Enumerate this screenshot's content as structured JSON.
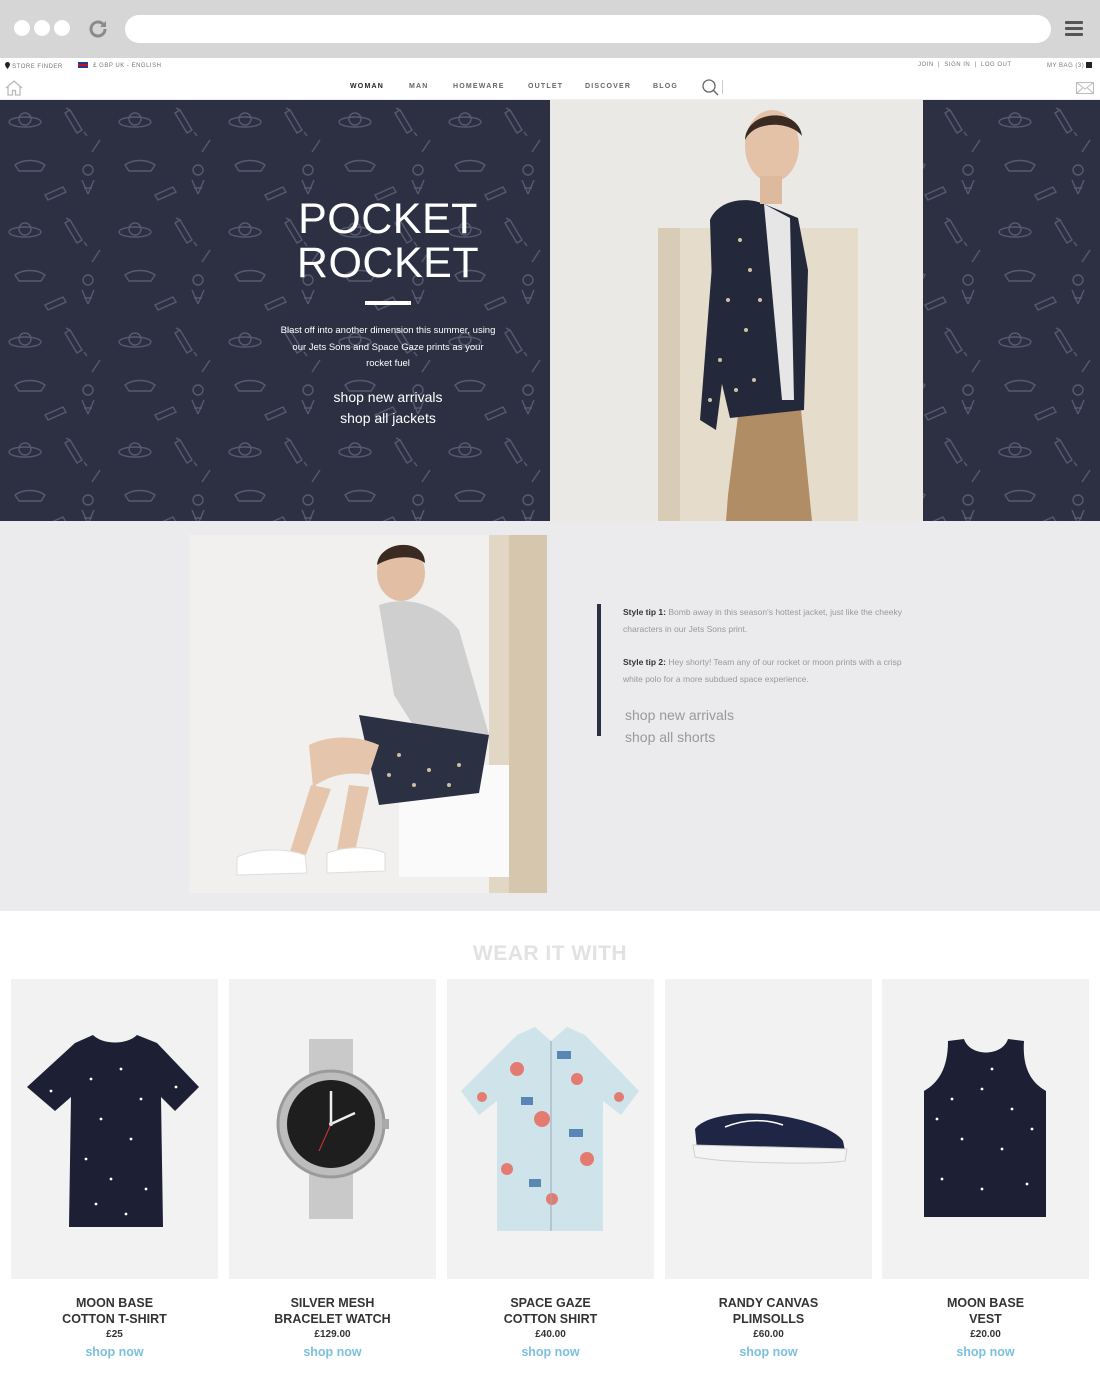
{
  "utility": {
    "store_finder": "STORE FINDER",
    "currency": "£ GBP UK - ENGLISH",
    "join": "JOIN",
    "sign_in": "SIGN IN",
    "log_out": "LOG OUT",
    "bag": "MY BAG (3)"
  },
  "nav": {
    "items": [
      "WOMAN",
      "MAN",
      "HOMEWARE",
      "OUTLET",
      "DISCOVER",
      "BLOG"
    ],
    "active": "WOMAN"
  },
  "hero": {
    "title_line1": "POCKET",
    "title_line2": "ROCKET",
    "text": "Blast off into another dimension this summer, using our Jets Sons and Space Gaze prints as your rocket fuel",
    "link1": "shop new arrivals",
    "link2": "shop all jackets"
  },
  "tips": {
    "tip1_label": "Style tip 1:",
    "tip1_text": " Bomb away in this season's hottest jacket, just like the cheeky characters in our Jets Sons print.",
    "tip2_label": "Style tip 2:",
    "tip2_text": " Hey shorty! Team any of our rocket or moon prints with a crisp white polo for a more subdued space experience.",
    "link1": "shop new arrivals",
    "link2": "shop all shorts"
  },
  "wear": {
    "heading": "WEAR IT WITH",
    "products": [
      {
        "name_line1": "MOON BASE",
        "name_line2": "COTTON T-SHIRT",
        "price": "£25",
        "cta": "shop now"
      },
      {
        "name_line1": "SILVER MESH",
        "name_line2": "BRACELET WATCH",
        "price": "£129.00",
        "cta": "shop now"
      },
      {
        "name_line1": "SPACE GAZE",
        "name_line2": "COTTON SHIRT",
        "price": "£40.00",
        "cta": "shop now"
      },
      {
        "name_line1": "RANDY CANVAS",
        "name_line2": "PLIMSOLLS",
        "price": "£60.00",
        "cta": "shop now"
      },
      {
        "name_line1": "MOON BASE",
        "name_line2": "VEST",
        "price": "£20.00",
        "cta": "shop now"
      }
    ]
  },
  "colors": {
    "navy": "#2d3042",
    "link_blue": "#7cc0dd",
    "panel_grey": "#ebebee"
  }
}
